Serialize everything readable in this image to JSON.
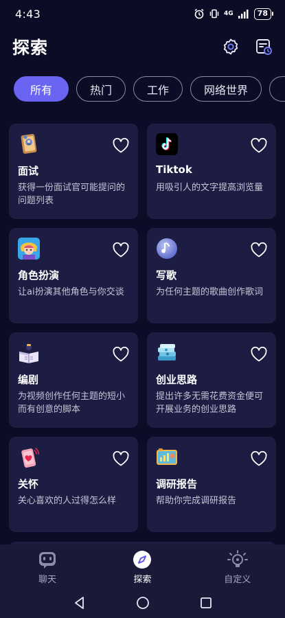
{
  "status_bar": {
    "time": "4:43",
    "network": "4G",
    "battery": "78"
  },
  "header": {
    "title": "探索",
    "icons": [
      "settings-icon",
      "history-icon"
    ]
  },
  "filters": {
    "chips": [
      "所有",
      "热门",
      "工作",
      "网络世界"
    ],
    "selected": "所有"
  },
  "cards": [
    {
      "icon": "interview-book-icon",
      "title": "面试",
      "desc": "获得一份面试官可能提问的问题列表"
    },
    {
      "icon": "tiktok-icon",
      "title": "Tiktok",
      "desc": "用吸引人的文字提高浏览量"
    },
    {
      "icon": "roleplay-character-icon",
      "title": "角色扮演",
      "desc": "让ai扮演其他角色与你交谈"
    },
    {
      "icon": "music-note-icon",
      "title": "写歌",
      "desc": "为任何主题的歌曲创作歌词"
    },
    {
      "icon": "script-book-icon",
      "title": "编剧",
      "desc": "为视频创作任何主题的短小而有创意的脚本"
    },
    {
      "icon": "money-stack-icon",
      "title": "创业思路",
      "desc": "提出许多无需花费资金便可开展业务的创业思路"
    },
    {
      "icon": "heart-phone-icon",
      "title": "关怀",
      "desc": "关心喜欢的人过得怎么样"
    },
    {
      "icon": "research-report-icon",
      "title": "调研报告",
      "desc": "帮助你完成调研报告"
    }
  ],
  "bottom_nav": {
    "items": [
      {
        "label": "聊天",
        "icon": "chat-robot-icon"
      },
      {
        "label": "探索",
        "icon": "compass-icon"
      },
      {
        "label": "自定义",
        "icon": "lightbulb-icon"
      }
    ],
    "active": "探索"
  },
  "colors": {
    "background": "#0d0c26",
    "card": "#1d1c43",
    "accent": "#6a64f2",
    "nav": "#1a1938"
  }
}
